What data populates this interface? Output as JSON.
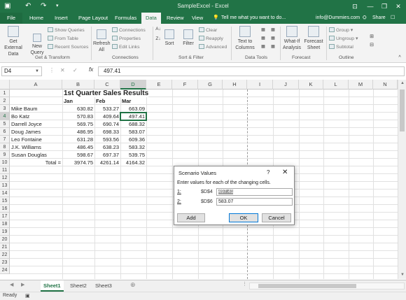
{
  "app": {
    "title": "SampleExcel - Excel",
    "question_placeholder": "Tell me what you want to do...",
    "user": "info@Dummies.com",
    "share": "Share",
    "file_tab": "File"
  },
  "tabs": [
    {
      "label": "Home"
    },
    {
      "label": "Insert"
    },
    {
      "label": "Page Layout"
    },
    {
      "label": "Formulas"
    },
    {
      "label": "Data",
      "active": true
    },
    {
      "label": "Review"
    },
    {
      "label": "View"
    }
  ],
  "ribbon": {
    "get_external_data": "Get External Data",
    "new_query": "New Query",
    "show_queries": "Show Queries",
    "from_table": "From Table",
    "recent_sources": "Recent Sources",
    "get_transform": "Get & Transform",
    "refresh_all": "Refresh All",
    "connections": "Connections",
    "properties": "Properties",
    "edit_links": "Edit Links",
    "connections_group": "Connections",
    "sort": "Sort",
    "filter": "Filter",
    "clear": "Clear",
    "reapply": "Reapply",
    "advanced": "Advanced",
    "sort_filter_group": "Sort & Filter",
    "text_to_columns": "Text to Columns",
    "data_tools_group": "Data Tools",
    "what_if": "What-If Analysis",
    "forecast_sheet": "Forecast Sheet",
    "forecast_group": "Forecast",
    "group": "Group",
    "ungroup": "Ungroup",
    "subtotal": "Subtotal",
    "outline_group": "Outline"
  },
  "formula_bar": {
    "name_box": "D4",
    "fx": "fx",
    "value": "497.41"
  },
  "columns": [
    "A",
    "B",
    "C",
    "D",
    "E",
    "F",
    "G",
    "H",
    "I",
    "J",
    "K",
    "L",
    "M",
    "N"
  ],
  "rows": [
    "1",
    "2",
    "3",
    "4",
    "5",
    "6",
    "7",
    "8",
    "9",
    "10",
    "11",
    "12",
    "13",
    "14",
    "15",
    "16",
    "17",
    "18",
    "19",
    "20",
    "21",
    "22",
    "23",
    "24"
  ],
  "sheet": {
    "title": "1st Quarter Sales Results",
    "headers": [
      "Jan",
      "Feb",
      "Mar"
    ],
    "data": [
      {
        "name": "Mike Baum",
        "jan": "630.82",
        "feb": "533.27",
        "mar": "663.09"
      },
      {
        "name": "Bo Katz",
        "jan": "570.83",
        "feb": "409.64",
        "mar": "497.41"
      },
      {
        "name": "Darrell Joyce",
        "jan": "569.75",
        "feb": "690.74",
        "mar": "688.32"
      },
      {
        "name": "Doug James",
        "jan": "486.95",
        "feb": "698.33",
        "mar": "583.07"
      },
      {
        "name": "Leo Fontaine",
        "jan": "631.28",
        "feb": "593.56",
        "mar": "609.36"
      },
      {
        "name": "J.K. Williams",
        "jan": "486.45",
        "feb": "638.23",
        "mar": "583.32"
      },
      {
        "name": "Susan Douglas",
        "jan": "598.67",
        "feb": "697.37",
        "mar": "539.75"
      }
    ],
    "total": {
      "label": "Total =",
      "jan": "3974.75",
      "feb": "4261.14",
      "mar": "4164.32"
    }
  },
  "dialog": {
    "title": "Scenario Values",
    "help": "?",
    "close": "✕",
    "instructions": "Enter values for each of the changing cells.",
    "rows": [
      {
        "label": "1:",
        "ref": "$D$4",
        "value": "497.41"
      },
      {
        "label": "2:",
        "ref": "$D$6",
        "value": "583.07"
      }
    ],
    "add": "Add",
    "ok": "OK",
    "cancel": "Cancel"
  },
  "sheet_tabs": [
    "Sheet1",
    "Sheet2",
    "Sheet3"
  ],
  "add_sheet": "⊕",
  "status": "Ready"
}
